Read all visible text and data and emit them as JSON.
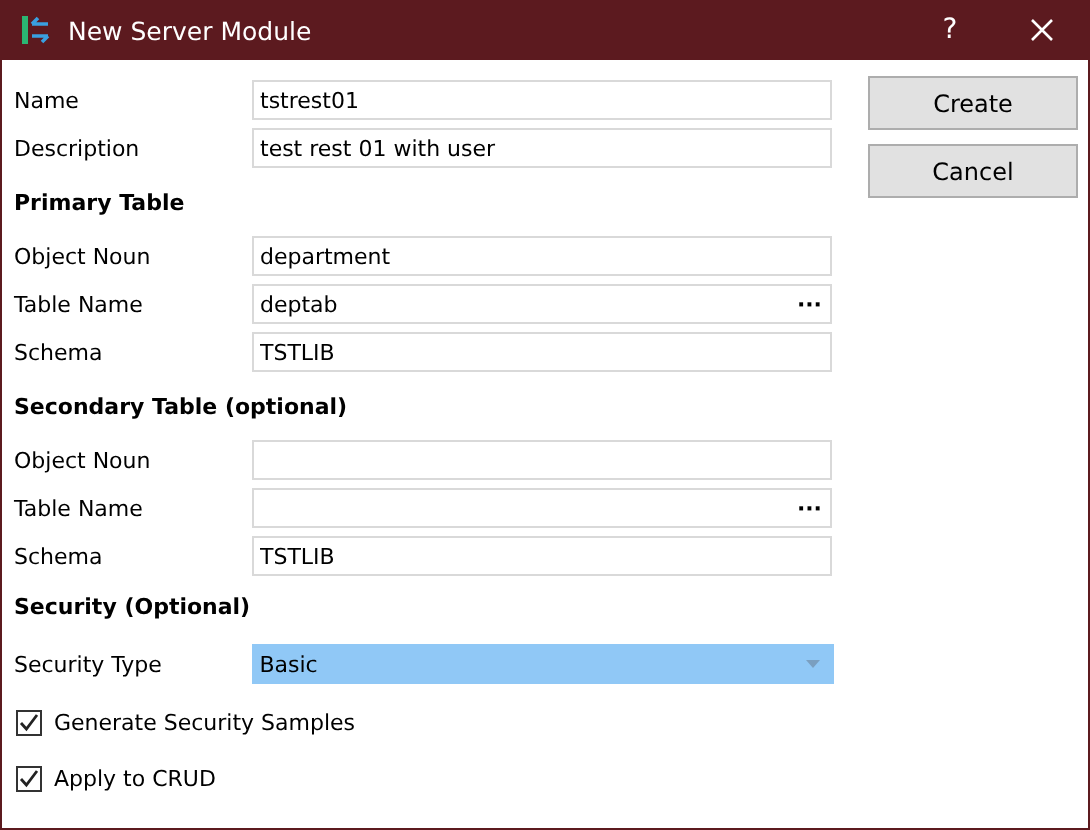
{
  "window": {
    "title": "New Server Module",
    "help": "?"
  },
  "rows": [
    {
      "kind": "field",
      "label": "Name",
      "value": "tstrest01"
    },
    {
      "kind": "field",
      "label": "Description",
      "value": "test rest 01 with user"
    },
    {
      "kind": "heading",
      "label": "Primary Table"
    },
    {
      "kind": "field",
      "label": "Object Noun",
      "value": "department"
    },
    {
      "kind": "field",
      "label": "Table Name",
      "value": "deptab",
      "button": "···"
    },
    {
      "kind": "field",
      "label": "Schema",
      "value": "TSTLIB"
    },
    {
      "kind": "heading",
      "label": "Secondary Table (optional)"
    },
    {
      "kind": "field",
      "label": "Object Noun",
      "value": ""
    },
    {
      "kind": "field",
      "label": "Table Name",
      "value": "",
      "button": "···"
    },
    {
      "kind": "field",
      "label": "Schema",
      "value": "TSTLIB"
    },
    {
      "kind": "heading",
      "label": "Security (Optional)"
    },
    {
      "kind": "dropdown",
      "label": "Security Type",
      "value": "Basic"
    },
    {
      "kind": "checkbox",
      "label": "Generate Security Samples",
      "checked": true
    },
    {
      "kind": "checkbox",
      "label": "Apply to CRUD",
      "checked": true
    }
  ],
  "buttons": [
    {
      "label": "Create"
    },
    {
      "label": "Cancel"
    }
  ]
}
